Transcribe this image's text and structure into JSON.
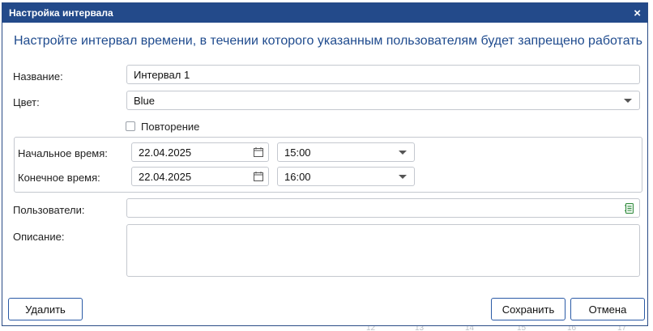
{
  "dialog": {
    "title": "Настройка интервала",
    "close_symbol": "×",
    "heading": "Настройте интервал времени, в течении которого указанным пользователям будет запрещено работать"
  },
  "form": {
    "name_label": "Название:",
    "name_value": "Интервал 1",
    "color_label": "Цвет:",
    "color_value": "Blue",
    "repeat_label": "Повторение",
    "repeat_checked": false,
    "start_label": "Начальное время:",
    "start_date": "22.04.2025",
    "start_time": "15:00",
    "end_label": "Конечное время:",
    "end_date": "22.04.2025",
    "end_time": "16:00",
    "users_label": "Пользователи:",
    "users_value": "",
    "description_label": "Описание:",
    "description_value": ""
  },
  "buttons": {
    "delete": "Удалить",
    "save": "Сохранить",
    "cancel": "Отмена"
  },
  "background_calendar": {
    "numbers": [
      "12",
      "13",
      "14",
      "15",
      "16",
      "17"
    ]
  },
  "colors": {
    "titlebar": "#234a8a",
    "heading": "#1f4b8e",
    "button_border": "#2a5aa6",
    "users_icon": "#2f8a3b"
  },
  "icons": {
    "close": "close-icon",
    "calendar": "calendar-icon",
    "dropdown": "chevron-down-icon",
    "users_picker": "address-book-icon"
  }
}
